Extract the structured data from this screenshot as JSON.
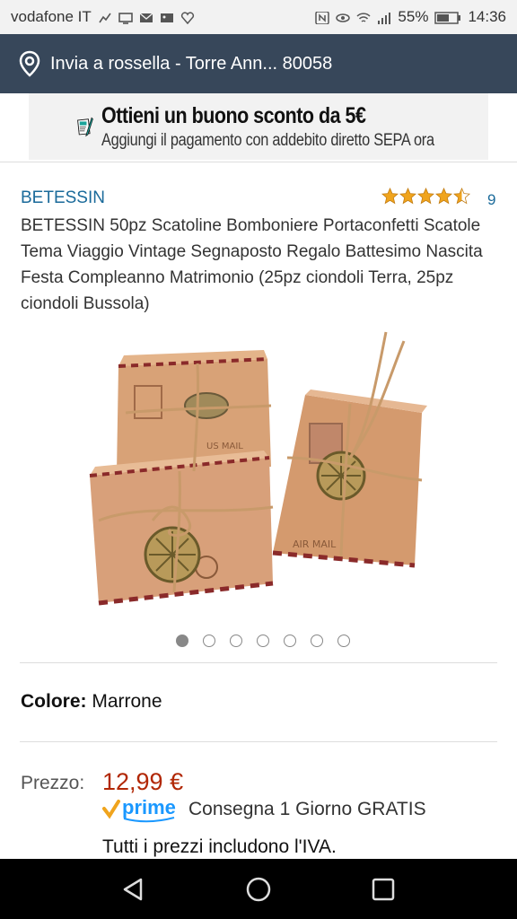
{
  "status_bar": {
    "carrier": "vodafone IT",
    "battery": "55%",
    "time": "14:36"
  },
  "delivery": {
    "text": "Invia a rossella - Torre Ann... 80058"
  },
  "banner": {
    "title": "Ottieni un buono sconto da 5€",
    "subtitle": "Aggiungi il pagamento con addebito diretto SEPA ora"
  },
  "product": {
    "brand": "BETESSIN",
    "rating": 4.5,
    "rating_count": "9",
    "title": "BETESSIN 50pz Scatoline Bomboniere Portaconfetti Scatole Tema Viaggio Vintage Segnaposto Regalo Battesimo Nascita Festa Compleanno Matrimonio (25pz ciondoli Terra, 25pz ciondoli Bussola)",
    "image_count": 7,
    "active_image": 0,
    "color_label": "Colore:",
    "color_value": "Marrone",
    "price_label": "Prezzo:",
    "price": "12,99 €",
    "prime_label": "prime",
    "delivery_text": "Consegna 1 Giorno GRATIS",
    "vat_text": "Tutti i prezzi includono l'IVA."
  },
  "colors": {
    "nav_dark": "#37475a",
    "link": "#1a6a9a",
    "price": "#b12704",
    "star": "#f0a41d",
    "prime_blue": "#1a98ff"
  }
}
